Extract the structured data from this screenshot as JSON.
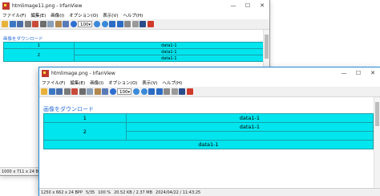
{
  "windows": [
    {
      "title": "htmlimage11.png - IrfanView",
      "menu": [
        "ファイル(F)",
        "編集(E)",
        "画像(I)",
        "オプション(O)",
        "表示(V)",
        "ヘルプ(H)"
      ],
      "zoom": "100",
      "heading": "画像をダウンロード",
      "table": {
        "row1": "1",
        "row2": "2",
        "cell_data": "data1-1"
      },
      "status": [
        "1000 x 711 x 24 BPP"
      ]
    },
    {
      "title": "htmlimage.png - IrfanView",
      "menu": [
        "ファイル(F)",
        "編集(E)",
        "画像(I)",
        "オプション(O)",
        "表示(V)",
        "ヘルプ(H)"
      ],
      "zoom": "100",
      "heading": "画像をダウンロード",
      "table": {
        "row1": "1",
        "row2": "2",
        "cell_data": "data1-1"
      },
      "status": [
        "1250 x 662 x 24 BPP",
        "5/35",
        "100 %",
        "20.52 KB / 2.37 MB",
        "2024/04/22 / 11:43:25"
      ]
    }
  ],
  "window_buttons": {
    "minimize": "—",
    "maximize": "☐",
    "close": "✕"
  },
  "colors": {
    "table_fill": "#00e5ee",
    "heading": "#2a6fd6",
    "app_icon": "#c0392b"
  },
  "toolbar_icons": [
    "open-icon",
    "thumbnails-icon",
    "save-icon",
    "save-as-icon",
    "delete-icon",
    "cut-icon",
    "copy-icon",
    "paste-icon",
    "undo-icon",
    "info-icon",
    "zoom-in-icon",
    "zoom-out-icon",
    "previous-icon",
    "next-icon",
    "fullscreen-icon",
    "slideshow-icon",
    "options-icon",
    "about-icon"
  ]
}
